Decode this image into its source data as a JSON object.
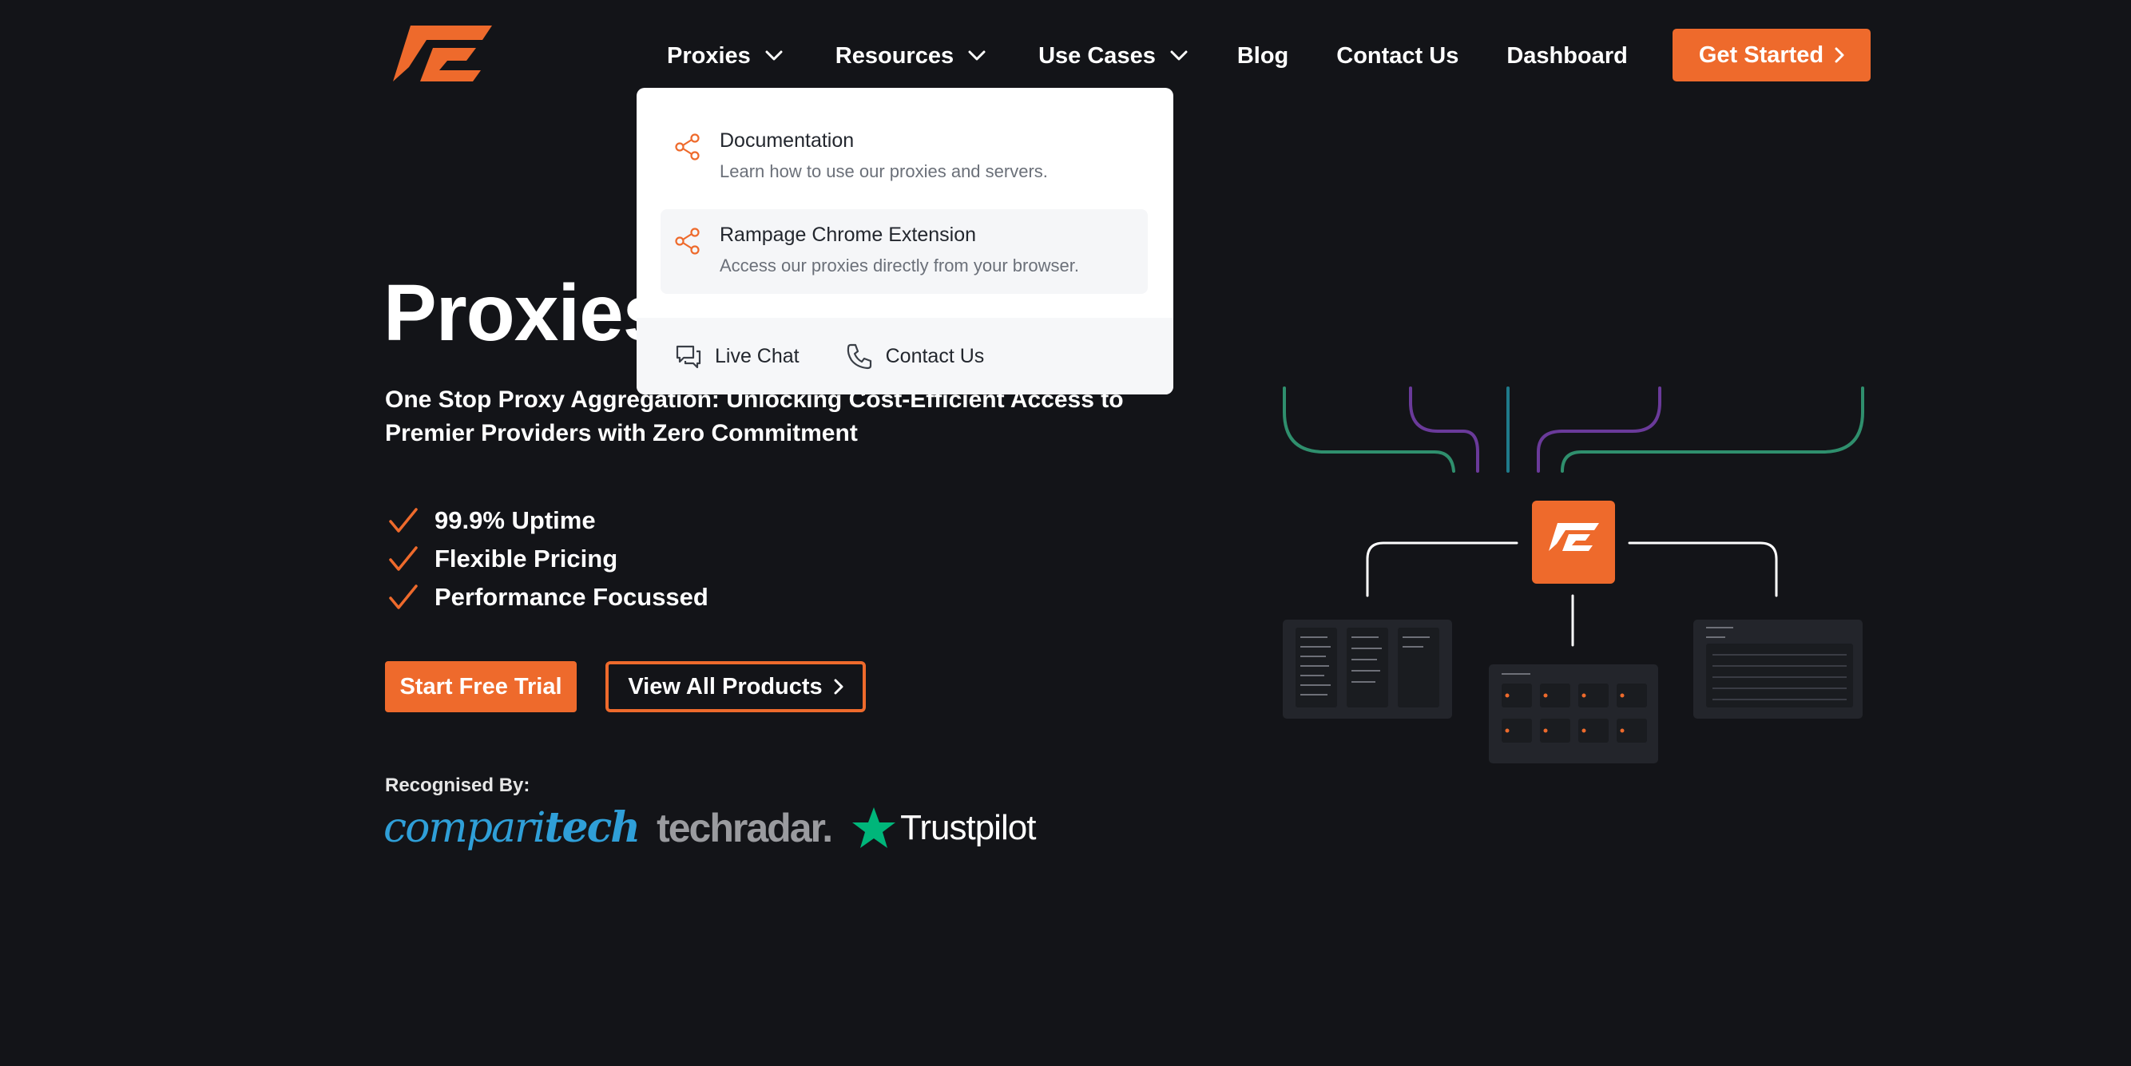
{
  "brand": {
    "logo_icon": "rampage-logo",
    "accent": "#ee6a2c",
    "background": "#131418"
  },
  "nav": {
    "items": [
      {
        "label": "Proxies",
        "has_dropdown": true
      },
      {
        "label": "Resources",
        "has_dropdown": true
      },
      {
        "label": "Use Cases",
        "has_dropdown": true
      },
      {
        "label": "Blog",
        "has_dropdown": false
      },
      {
        "label": "Contact Us",
        "has_dropdown": false
      },
      {
        "label": "Dashboard",
        "has_dropdown": false
      }
    ],
    "cta_label": "Get Started"
  },
  "dropdown": {
    "items": [
      {
        "title": "Documentation",
        "description": "Learn how to use our proxies and servers.",
        "icon": "share-icon"
      },
      {
        "title": "Rampage Chrome Extension",
        "description": "Access our proxies directly from your browser.",
        "icon": "share-icon"
      }
    ],
    "footer": [
      {
        "label": "Live Chat",
        "icon": "chat-icon"
      },
      {
        "label": "Contact Us",
        "icon": "phone-icon"
      }
    ]
  },
  "hero": {
    "title": "Proxies",
    "subtitle": "One Stop Proxy Aggregation: Unlocking Cost-Efficient Access to Premier Providers with Zero Commitment",
    "features": [
      "99.9% Uptime",
      "Flexible Pricing",
      "Performance Focussed"
    ],
    "primary_button": "Start Free Trial",
    "secondary_button": "View All Products"
  },
  "recognition": {
    "label": "Recognised By:",
    "brands": {
      "comparitech_light": "compari",
      "comparitech_bold": "tech",
      "techradar": "techradar.",
      "trustpilot": "Trustpilot"
    }
  }
}
